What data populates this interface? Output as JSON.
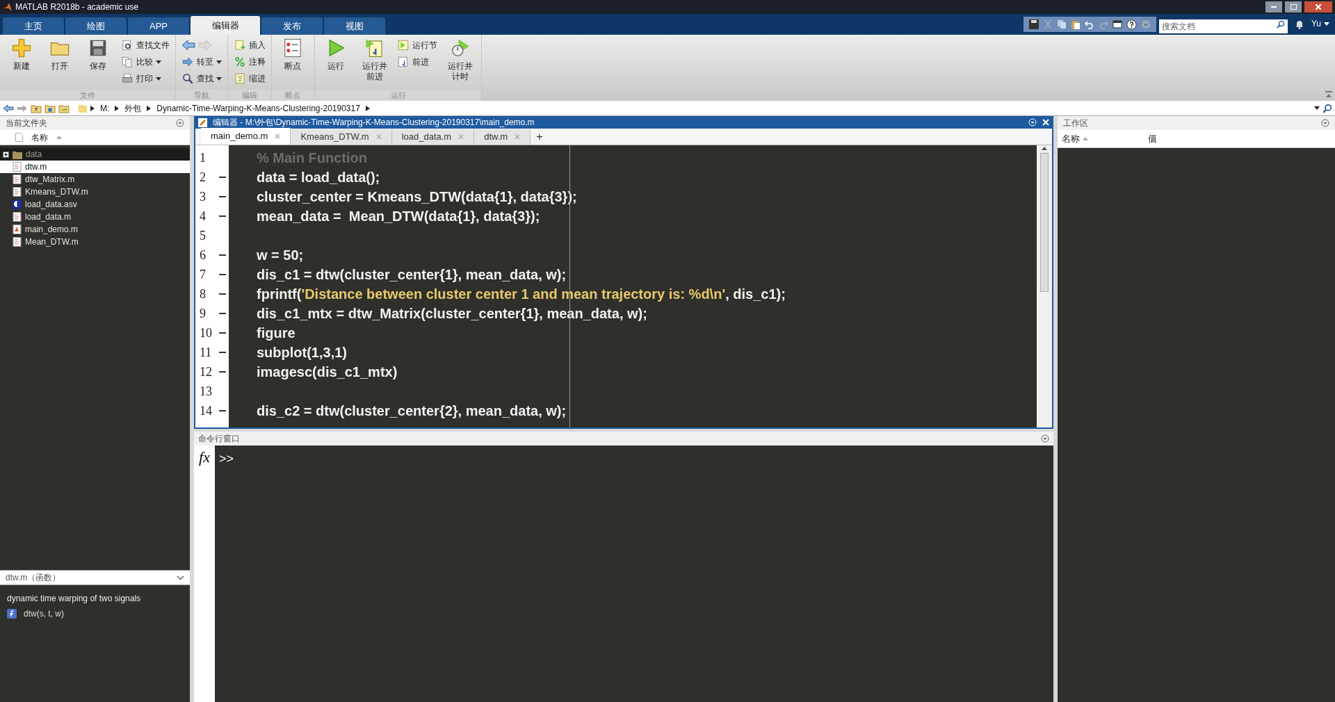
{
  "window": {
    "title": "MATLAB R2018b - academic use"
  },
  "ribbon_tabs": [
    {
      "label": "主页",
      "selected": false
    },
    {
      "label": "绘图",
      "selected": false
    },
    {
      "label": "APP",
      "selected": false
    },
    {
      "label": "编辑器",
      "selected": true
    },
    {
      "label": "发布",
      "selected": false
    },
    {
      "label": "视图",
      "selected": false
    }
  ],
  "search": {
    "placeholder": "搜索文档"
  },
  "user": "Yu",
  "toolstrip": [
    {
      "label": "文件",
      "groups": [
        [
          {
            "label": "新建",
            "kind": "large"
          }
        ],
        [
          {
            "label": "打开",
            "kind": "large"
          }
        ],
        [
          {
            "label": "保存",
            "kind": "large"
          }
        ],
        [
          {
            "label": "查找文件",
            "kind": "small",
            "dropdown": false
          },
          {
            "label": "比较",
            "kind": "small",
            "dropdown": true
          },
          {
            "label": "打印",
            "kind": "small",
            "dropdown": true
          }
        ]
      ]
    },
    {
      "label": "导航",
      "groups": [
        [
          {
            "label": "转至",
            "kind": "small",
            "dropdown": true
          },
          {
            "label": "查找",
            "kind": "small",
            "dropdown": true
          }
        ]
      ]
    },
    {
      "label": "编辑",
      "groups": [
        [
          {
            "label": "插入",
            "kind": "small",
            "dropdown": false
          },
          {
            "label": "注释",
            "kind": "small",
            "dropdown": false
          },
          {
            "label": "缩进",
            "kind": "small",
            "dropdown": false
          }
        ]
      ]
    },
    {
      "label": "断点",
      "groups": [
        [
          {
            "label": "断点",
            "kind": "large"
          }
        ]
      ]
    },
    {
      "label": "运行",
      "groups": [
        [
          {
            "label": "运行",
            "kind": "large"
          }
        ],
        [
          {
            "label": "运行并前进",
            "kind": "large"
          }
        ],
        [
          {
            "label": "运行节",
            "kind": "small",
            "dropdown": false
          },
          {
            "label": "前进",
            "kind": "small",
            "dropdown": false
          }
        ],
        [
          {
            "label": "运行并计时",
            "kind": "large"
          }
        ]
      ]
    }
  ],
  "address": [
    "M:",
    "外包",
    "Dynamic-Time-Warping-K-Means-Clustering-20190317"
  ],
  "current_folder": {
    "title": "当前文件夹",
    "column": "名称",
    "items": [
      {
        "name": "data",
        "kind": "folder",
        "selected": false
      },
      {
        "name": "dtw.m",
        "kind": "function",
        "selected": true
      },
      {
        "name": "dtw_Matrix.m",
        "kind": "function",
        "selected": false
      },
      {
        "name": "Kmeans_DTW.m",
        "kind": "function",
        "selected": false
      },
      {
        "name": "load_data.asv",
        "kind": "asv",
        "selected": false
      },
      {
        "name": "load_data.m",
        "kind": "function",
        "selected": false
      },
      {
        "name": "main_demo.m",
        "kind": "script",
        "selected": false
      },
      {
        "name": "Mean_DTW.m",
        "kind": "function",
        "selected": false
      }
    ]
  },
  "details": {
    "header": "dtw.m（函数）",
    "description": "dynamic time warping of two signals",
    "signature": "dtw(s, t, w)"
  },
  "editor": {
    "title": "编辑器 - M:\\外包\\Dynamic-Time-Warping-K-Means-Clustering-20190317\\main_demo.m",
    "tabs": [
      {
        "label": "main_demo.m",
        "selected": true
      },
      {
        "label": "Kmeans_DTW.m",
        "selected": false
      },
      {
        "label": "load_data.m",
        "selected": false
      },
      {
        "label": "dtw.m",
        "selected": false
      }
    ],
    "new_tab": "+",
    "lines": [
      {
        "number": "1",
        "dash": false,
        "segments": [
          {
            "text": "% Main Function",
            "kind": "comment"
          }
        ]
      },
      {
        "number": "2",
        "dash": true,
        "segments": [
          {
            "text": "data = load_data();",
            "kind": "code"
          }
        ]
      },
      {
        "number": "3",
        "dash": true,
        "segments": [
          {
            "text": "cluster_center = Kmeans_DTW(data{1}, data{3});",
            "kind": "code"
          }
        ]
      },
      {
        "number": "4",
        "dash": true,
        "segments": [
          {
            "text": "mean_data =  Mean_DTW(data{1}, data{3});",
            "kind": "code"
          }
        ]
      },
      {
        "number": "5",
        "dash": false
      },
      {
        "number": "6",
        "dash": true,
        "segments": [
          {
            "text": "w = 50;",
            "kind": "code"
          }
        ]
      },
      {
        "number": "7",
        "dash": true,
        "segments": [
          {
            "text": "dis_c1 = dtw(cluster_center{1}, mean_data, w);",
            "kind": "code"
          }
        ]
      },
      {
        "number": "8",
        "dash": true,
        "segments": [
          {
            "text": "fprintf(",
            "kind": "code"
          },
          {
            "text": "'Distance between cluster center 1 and mean trajectory is: %d\\n'",
            "kind": "string"
          },
          {
            "text": ", dis_c1);",
            "kind": "code"
          }
        ]
      },
      {
        "number": "9",
        "dash": true,
        "segments": [
          {
            "text": "dis_c1_mtx = dtw_Matrix(cluster_center{1}, mean_data, w);",
            "kind": "code"
          }
        ]
      },
      {
        "number": "10",
        "dash": true,
        "segments": [
          {
            "text": "figure",
            "kind": "code"
          }
        ]
      },
      {
        "number": "11",
        "dash": true,
        "segments": [
          {
            "text": "subplot(1,3,1)",
            "kind": "code"
          }
        ]
      },
      {
        "number": "12",
        "dash": true,
        "segments": [
          {
            "text": "imagesc(dis_c1_mtx)",
            "kind": "code"
          }
        ]
      },
      {
        "number": "13",
        "dash": false
      },
      {
        "number": "14",
        "dash": true,
        "segments": [
          {
            "text": "dis_c2 = dtw(cluster_center{2}, mean_data, w);",
            "kind": "code"
          }
        ]
      }
    ]
  },
  "command_window": {
    "title": "命令行窗口",
    "fx_label": "fx",
    "prompt": ">>"
  },
  "workspace": {
    "title": "工作区",
    "columns": [
      "名称",
      "值"
    ]
  }
}
